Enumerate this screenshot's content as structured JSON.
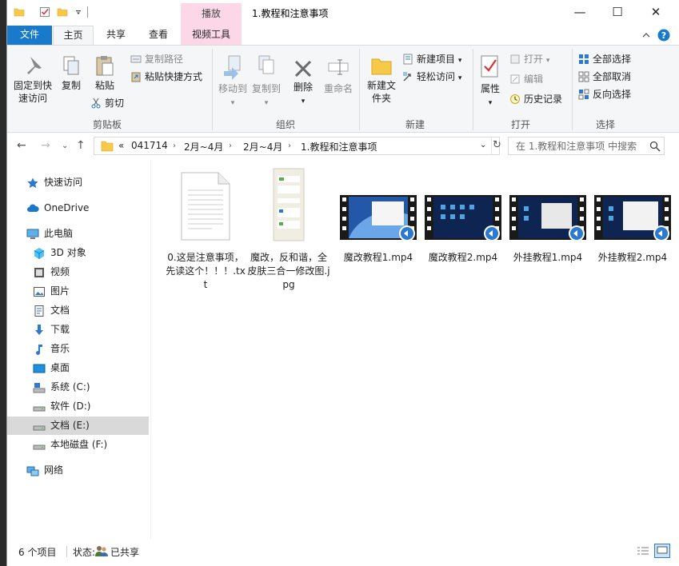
{
  "window": {
    "title": "1.教程和注意事项",
    "contextual_tab": "播放",
    "minimize_glyph": "—",
    "maximize_glyph": "☐",
    "close_glyph": "✕"
  },
  "ribbon_tabs": {
    "file": "文件",
    "home": "主页",
    "share": "共享",
    "view": "查看",
    "video_tools": "视频工具"
  },
  "ribbon": {
    "clipboard": {
      "label": "剪贴板",
      "pin": "固定到快速访问",
      "copy": "复制",
      "paste": "粘贴",
      "copy_path": "复制路径",
      "paste_shortcut": "粘贴快捷方式",
      "cut": "剪切"
    },
    "organize": {
      "label": "组织",
      "move_to": "移动到",
      "copy_to": "复制到",
      "delete": "删除",
      "rename": "重命名"
    },
    "new": {
      "label": "新建",
      "new_folder": "新建文件夹",
      "new_item": "新建项目",
      "easy_access": "轻松访问"
    },
    "open": {
      "label": "打开",
      "properties": "属性",
      "open": "打开",
      "edit": "编辑",
      "history": "历史记录"
    },
    "select": {
      "label": "选择",
      "select_all": "全部选择",
      "select_none": "全部取消",
      "invert": "反向选择"
    }
  },
  "address": {
    "overflow": "«",
    "crumbs": [
      "041714",
      "2月~4月",
      "2月~4月",
      "1.教程和注意事项"
    ],
    "search_placeholder": "在 1.教程和注意事项 中搜索"
  },
  "nav": {
    "quick_access": "快速访问",
    "onedrive": "OneDrive",
    "this_pc": "此电脑",
    "objects3d": "3D 对象",
    "videos": "视频",
    "pictures": "图片",
    "documents": "文档",
    "downloads": "下载",
    "music": "音乐",
    "desktop": "桌面",
    "drive_c": "系统 (C:)",
    "drive_d": "软件 (D:)",
    "drive_e": "文档 (E:)",
    "drive_f": "本地磁盘 (F:)",
    "network": "网络"
  },
  "files": [
    {
      "name": "0.这是注意事项，先读这个！！！.txt",
      "kind": "text"
    },
    {
      "name": "魔改，反和谐，全皮肤三合一修改图.jpg",
      "kind": "image"
    },
    {
      "name": "魔改教程1.mp4",
      "kind": "video"
    },
    {
      "name": "魔改教程2.mp4",
      "kind": "video"
    },
    {
      "name": "外挂教程1.mp4",
      "kind": "video"
    },
    {
      "name": "外挂教程2.mp4",
      "kind": "video"
    }
  ],
  "status": {
    "count": "6 个项目",
    "state_label": "状态:",
    "state_value": "已共享"
  },
  "colors": {
    "accent": "#1979ca",
    "contextual": "#fbd7e8",
    "selected_nav": "#d9d9d9"
  }
}
